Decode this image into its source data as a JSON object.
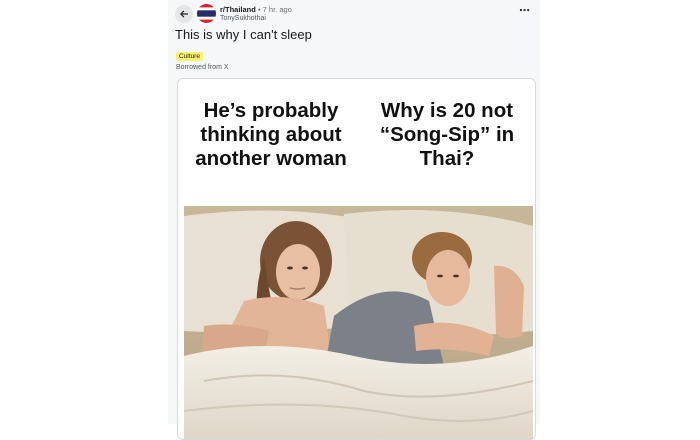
{
  "post": {
    "subreddit": "r/Thailand",
    "separator": "•",
    "time_ago": "7 hr. ago",
    "username": "TonySukhothai",
    "title": "This is why I can't sleep",
    "flair": "Culture",
    "subtitle": "Borrowed from X",
    "more_icon": "⋯"
  },
  "meme": {
    "caption_left": "He’s probably thinking about another woman",
    "caption_right": "Why is 20 not “Song-Sip” in Thai?"
  },
  "icons": {
    "back": "arrow-left-icon",
    "avatar": "thai-flag-avatar",
    "more": "more-options-icon"
  },
  "colors": {
    "page_bg": "#f5f7f8",
    "flair_bg": "#fbf26b",
    "flag_red": "#d6222f",
    "flag_blue": "#262d6b"
  }
}
